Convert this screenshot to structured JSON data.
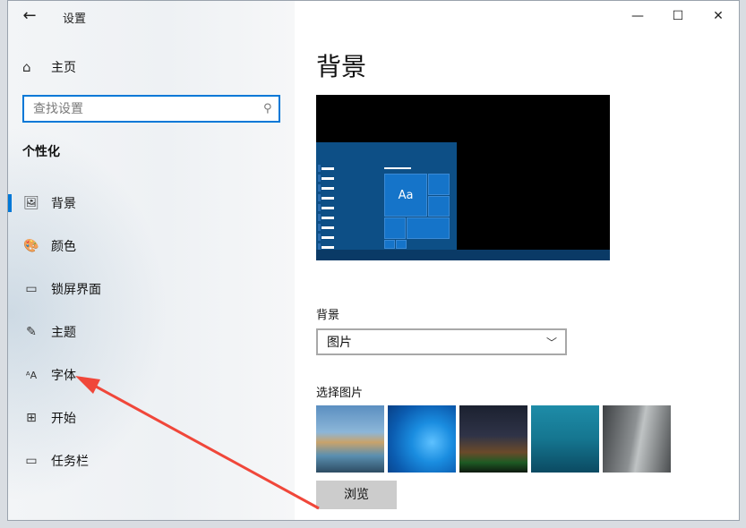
{
  "window": {
    "title": "设置",
    "back_glyph": "←",
    "minimize_glyph": "—",
    "maximize_glyph": "☐",
    "close_glyph": "✕"
  },
  "sidebar": {
    "home_label": "主页",
    "search_placeholder": "查找设置",
    "section_title": "个性化",
    "items": [
      {
        "label": "背景",
        "icon": "image-icon",
        "glyph": "🖼"
      },
      {
        "label": "颜色",
        "icon": "palette-icon",
        "glyph": "🎨"
      },
      {
        "label": "锁屏界面",
        "icon": "lock-screen-icon",
        "glyph": "▭"
      },
      {
        "label": "主题",
        "icon": "theme-icon",
        "glyph": "✎"
      },
      {
        "label": "字体",
        "icon": "font-icon",
        "glyph": "ᴬA"
      },
      {
        "label": "开始",
        "icon": "start-icon",
        "glyph": "⊞"
      },
      {
        "label": "任务栏",
        "icon": "taskbar-icon",
        "glyph": "▭"
      }
    ],
    "active_index": 0
  },
  "main": {
    "title": "背景",
    "preview_tile_text": "Aa",
    "background_label": "背景",
    "background_value": "图片",
    "choose_picture_label": "选择图片",
    "browse_label": "浏览"
  },
  "colors": {
    "accent": "#0078d7",
    "annotation_arrow": "#f0473a"
  }
}
